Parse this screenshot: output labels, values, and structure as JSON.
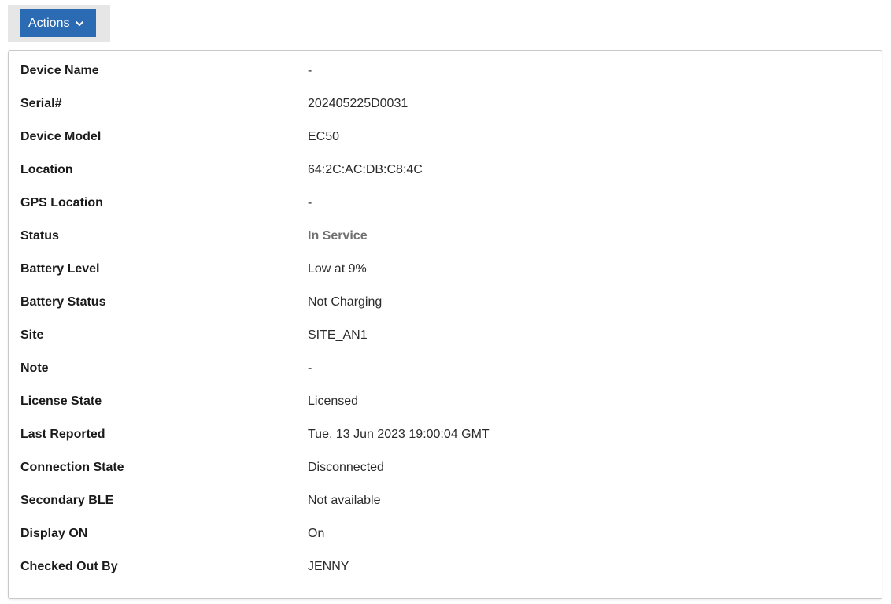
{
  "toolbar": {
    "actions_label": "Actions"
  },
  "details": [
    {
      "label": "Device Name",
      "value": "-"
    },
    {
      "label": "Serial#",
      "value": "202405225D0031"
    },
    {
      "label": "Device Model",
      "value": "EC50"
    },
    {
      "label": "Location",
      "value": "64:2C:AC:DB:C8:4C"
    },
    {
      "label": "GPS Location",
      "value": "-"
    },
    {
      "label": "Status",
      "value": "In Service"
    },
    {
      "label": "Battery Level",
      "value": "Low at 9%"
    },
    {
      "label": "Battery Status",
      "value": "Not Charging"
    },
    {
      "label": "Site",
      "value": "SITE_AN1"
    },
    {
      "label": "Note",
      "value": "-"
    },
    {
      "label": "License State",
      "value": "Licensed"
    },
    {
      "label": "Last Reported",
      "value": "Tue, 13 Jun 2023 19:00:04 GMT"
    },
    {
      "label": "Connection State",
      "value": "Disconnected"
    },
    {
      "label": "Secondary BLE",
      "value": "Not available"
    },
    {
      "label": "Display ON",
      "value": "On"
    },
    {
      "label": "Checked Out By",
      "value": "JENNY"
    }
  ],
  "colors": {
    "accent": "#2a6bb3",
    "status_text": "#707070"
  },
  "icons": {
    "actions_dropdown": "chevron-down-icon"
  }
}
